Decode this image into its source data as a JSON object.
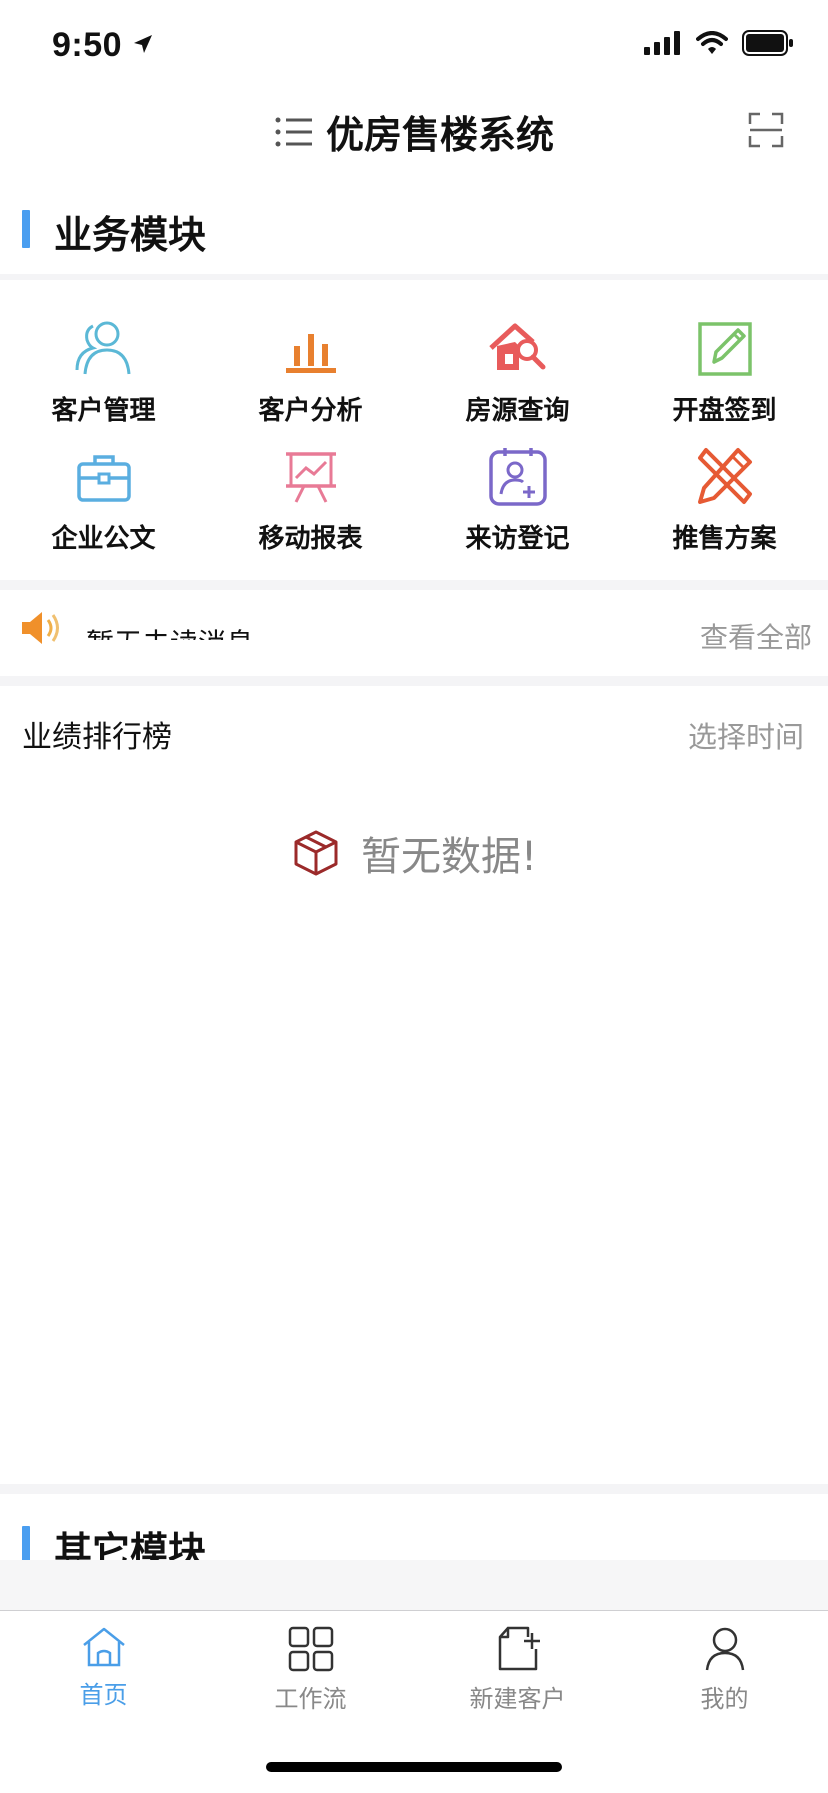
{
  "status": {
    "time": "9:50"
  },
  "header": {
    "title": "优房售楼系统"
  },
  "business_section": {
    "title": "业务模块"
  },
  "modules": [
    {
      "label": "客户管理",
      "icon": "customers-icon",
      "color": "#5bb8d6"
    },
    {
      "label": "客户分析",
      "icon": "bar-chart-icon",
      "color": "#e8802f"
    },
    {
      "label": "房源查询",
      "icon": "house-search-icon",
      "color": "#e85b5b"
    },
    {
      "label": "开盘签到",
      "icon": "edit-checkin-icon",
      "color": "#7cc36a"
    },
    {
      "label": "企业公文",
      "icon": "briefcase-icon",
      "color": "#5aaee0"
    },
    {
      "label": "移动报表",
      "icon": "presentation-chart-icon",
      "color": "#e87a96"
    },
    {
      "label": "来访登记",
      "icon": "add-contact-icon",
      "color": "#7b68c9"
    },
    {
      "label": "推售方案",
      "icon": "pencil-ruler-icon",
      "color": "#e65a34"
    }
  ],
  "notice": {
    "text": "暂无未读消息",
    "view_all": "查看全部"
  },
  "ranking": {
    "title": "业绩排行榜",
    "select_time": "选择时间",
    "empty_text": "暂无数据!"
  },
  "other_section": {
    "title": "其它模块"
  },
  "tabs": [
    {
      "label": "首页",
      "icon": "home-icon",
      "active": true
    },
    {
      "label": "工作流",
      "icon": "grid-icon",
      "active": false
    },
    {
      "label": "新建客户",
      "icon": "new-document-icon",
      "active": false
    },
    {
      "label": "我的",
      "icon": "user-icon",
      "active": false
    }
  ],
  "colors": {
    "accent": "#4a9ef0",
    "tab_active": "#4a9ee8",
    "muted": "#999999",
    "empty_box": "#9b2a2a"
  }
}
